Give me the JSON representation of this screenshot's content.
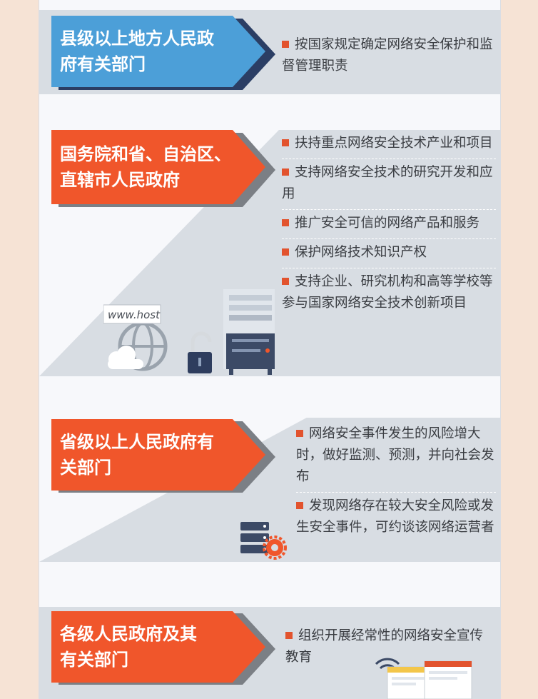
{
  "sections": [
    {
      "header": "县级以上地方人民政府有关部门",
      "header_lines": [
        "县级以上地方人民政",
        "府有关部门"
      ],
      "color": "#4c9fd8",
      "items": [
        "按国家规定确定网络安全保护和监督管理职责"
      ]
    },
    {
      "header": "国务院和省、自治区、直辖市人民政府",
      "header_lines": [
        "国务院和省、自治区、",
        "直辖市人民政府"
      ],
      "color": "#f0562b",
      "items": [
        "扶持重点网络安全技术产业和项目",
        "支持网络安全技术的研究开发和应用",
        "推广安全可信的网络产品和服务",
        "保护网络技术知识产权",
        "支持企业、研究机构和高等学校等参与国家网络安全技术创新项目"
      ]
    },
    {
      "header": "省级以上人民政府有关部门",
      "header_lines": [
        "省级以上人民政府有",
        "关部门"
      ],
      "color": "#f0562b",
      "items": [
        "网络安全事件发生的风险增大时，做好监测、预测，并向社会发布",
        "发现网络存在较大安全风险或发生安全事件，可约谈该网络运营者"
      ]
    },
    {
      "header": "各级人民政府及其有关部门",
      "header_lines": [
        "各级人民政府及其",
        "有关部门"
      ],
      "color": "#f0562b",
      "items": [
        "组织开展经常性的网络安全宣传教育"
      ]
    }
  ],
  "illustration": {
    "url_text": "www.host"
  },
  "icons": [
    "bullet-square-icon",
    "cloud-icon",
    "padlock-icon",
    "globe-icon",
    "server-icon",
    "gear-icon",
    "wifi-icon",
    "browser-window-icon"
  ]
}
